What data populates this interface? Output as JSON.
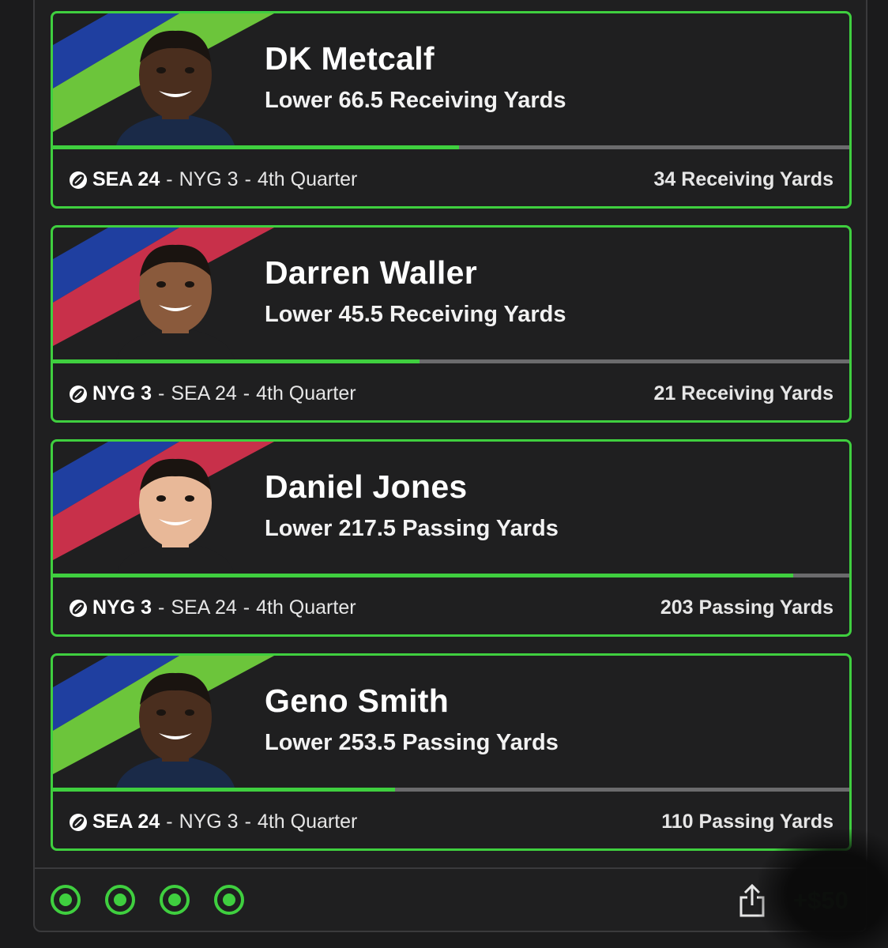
{
  "legs": [
    {
      "player": "DK Metcalf",
      "prop": "Lower 66.5 Receiving Yards",
      "team_bold": "SEA 24",
      "opponent": "NYG 3",
      "period": "4th Quarter",
      "actual": "34 Receiving Yards",
      "progress": 0.51,
      "team_colors": [
        "#1f3fa0",
        "#6cc53b"
      ],
      "jersey_color": "#1a2a48",
      "skin_color": "#4a2e1e"
    },
    {
      "player": "Darren Waller",
      "prop": "Lower 45.5 Receiving Yards",
      "team_bold": "NYG 3",
      "opponent": "SEA 24",
      "period": "4th Quarter",
      "actual": "21 Receiving Yards",
      "progress": 0.46,
      "team_colors": [
        "#1f3fa0",
        "#c8304a"
      ],
      "jersey_color": "#1f1f20",
      "skin_color": "#8a5a3c"
    },
    {
      "player": "Daniel Jones",
      "prop": "Lower 217.5 Passing Yards",
      "team_bold": "NYG 3",
      "opponent": "SEA 24",
      "period": "4th Quarter",
      "actual": "203 Passing Yards",
      "progress": 0.93,
      "team_colors": [
        "#1f3fa0",
        "#c8304a"
      ],
      "jersey_color": "#1f1f20",
      "skin_color": "#e8b898"
    },
    {
      "player": "Geno Smith",
      "prop": "Lower 253.5 Passing Yards",
      "team_bold": "SEA 24",
      "opponent": "NYG 3",
      "period": "4th Quarter",
      "actual": "110 Passing Yards",
      "progress": 0.43,
      "team_colors": [
        "#1f3fa0",
        "#6cc53b"
      ],
      "jersey_color": "#1a2a48",
      "skin_color": "#4a2e1e"
    }
  ],
  "footer": {
    "status_dot_count": 4,
    "status_color": "#3fcf3f",
    "share_icon": "share-icon",
    "payout": "+$50"
  },
  "accent_color": "#3fcf3f"
}
